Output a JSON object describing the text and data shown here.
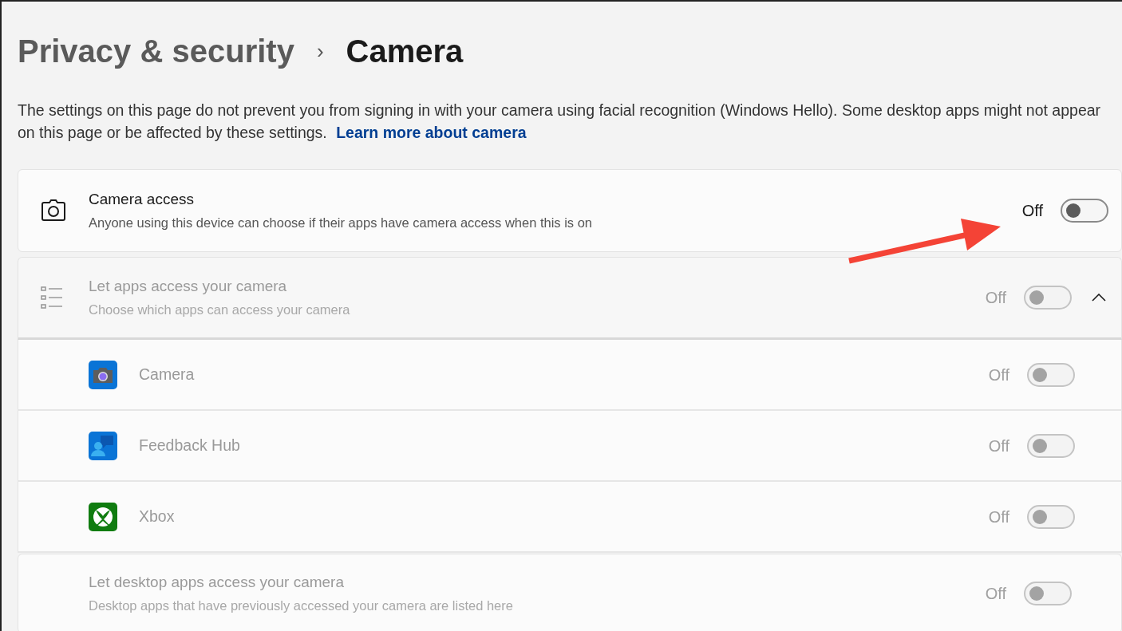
{
  "breadcrumb": {
    "parent": "Privacy & security",
    "separator": "›",
    "current": "Camera"
  },
  "description": {
    "text": "The settings on this page do not prevent you from signing in with your camera using facial recognition (Windows Hello). Some desktop apps might not appear on this page or be affected by these settings.",
    "link": "Learn more about camera"
  },
  "settings": [
    {
      "kind": "camera",
      "title": "Camera access",
      "subtitle": "Anyone using this device can choose if their apps have camera access when this is on",
      "state_label": "Off",
      "on": false,
      "disabled": false
    },
    {
      "kind": "list",
      "title": "Let apps access your camera",
      "subtitle": "Choose which apps can access your camera",
      "state_label": "Off",
      "on": false,
      "disabled": true,
      "expanded": true,
      "apps": [
        {
          "kind": "camera",
          "name": "Camera",
          "state_label": "Off",
          "on": false,
          "disabled": true
        },
        {
          "kind": "feedback",
          "name": "Feedback Hub",
          "state_label": "Off",
          "on": false,
          "disabled": true
        },
        {
          "kind": "xbox",
          "name": "Xbox",
          "state_label": "Off",
          "on": false,
          "disabled": true
        }
      ]
    },
    {
      "kind": "none",
      "title": "Let desktop apps access your camera",
      "subtitle": "Desktop apps that have previously accessed your camera are listed here",
      "state_label": "Off",
      "on": false,
      "disabled": true
    }
  ]
}
